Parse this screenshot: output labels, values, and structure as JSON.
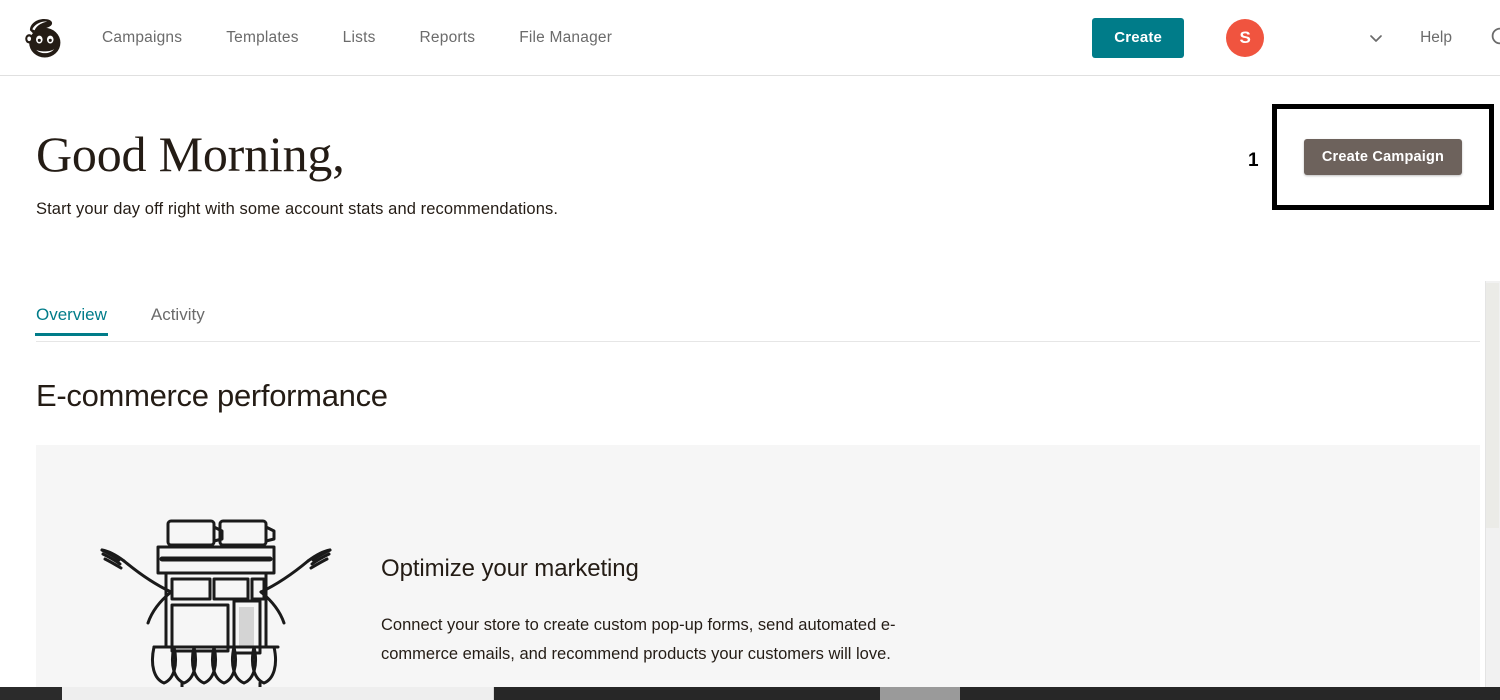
{
  "topnav": {
    "logo_name": "mailchimp-freddie-logo",
    "links": [
      {
        "label": "Campaigns"
      },
      {
        "label": "Templates"
      },
      {
        "label": "Lists"
      },
      {
        "label": "Reports"
      },
      {
        "label": "File Manager"
      }
    ],
    "create_button": "Create",
    "avatar_initial": "S",
    "help_label": "Help",
    "icons": {
      "chevron": "chevron-down-icon",
      "search": "search-icon"
    },
    "colors": {
      "create_bg": "#007c89",
      "avatar_bg": "#f0543f"
    }
  },
  "hero": {
    "greeting": "Good Morning,",
    "subtitle": "Start your day off right with some account stats and recommendations."
  },
  "annotation": {
    "number": "1",
    "button_label": "Create Campaign",
    "button_color": "#6d625c",
    "box_border_color": "#000000"
  },
  "tabs": [
    {
      "label": "Overview",
      "active": true
    },
    {
      "label": "Activity",
      "active": false
    }
  ],
  "main": {
    "section_title": "E-commerce performance",
    "promo": {
      "illustration_name": "storefront-shrug-illustration",
      "title": "Optimize your marketing",
      "body": "Connect your store to create custom pop-up forms, send automated e-commerce emails, and recommend products your customers will love."
    }
  },
  "theme": {
    "accent_teal": "#007c89",
    "text_dark": "#241c15",
    "text_muted": "#6b6b6b",
    "card_bg": "#f6f6f6"
  }
}
